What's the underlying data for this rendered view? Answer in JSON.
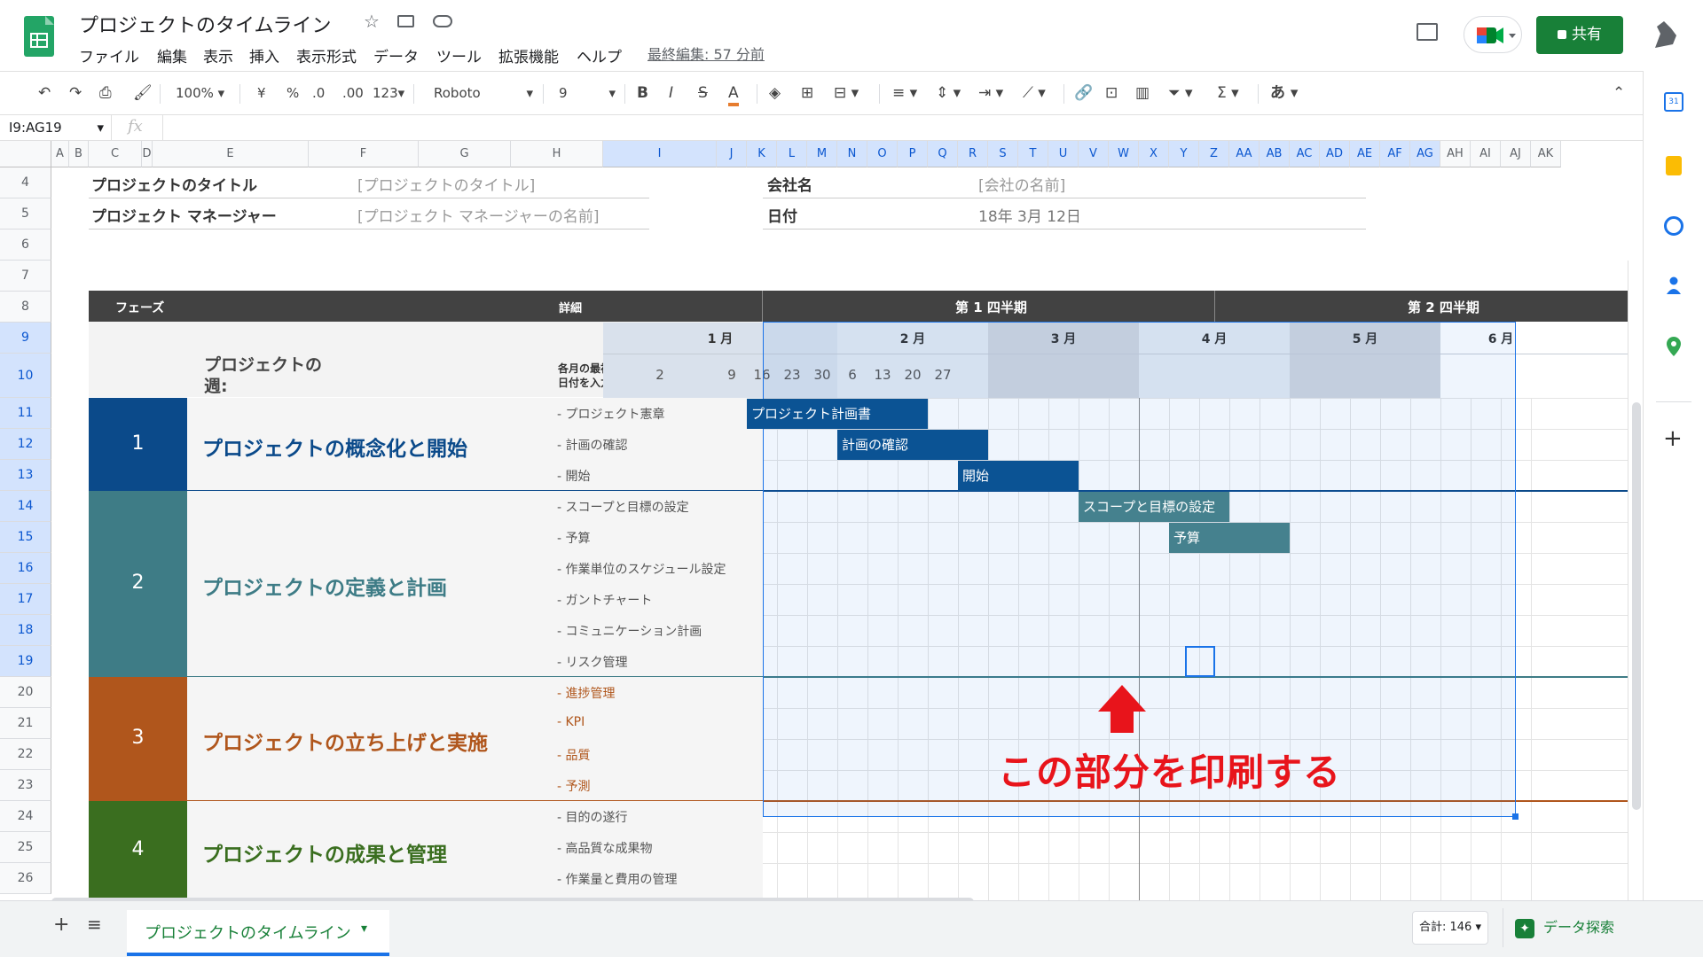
{
  "doc": {
    "title": "プロジェクトのタイムライン",
    "last_edit": "最終編集: 57 分前",
    "share_label": "共有"
  },
  "menu": [
    "ファイル",
    "編集",
    "表示",
    "挿入",
    "表示形式",
    "データ",
    "ツール",
    "拡張機能",
    "ヘルプ"
  ],
  "toolbar": {
    "zoom": "100%",
    "currency": "¥",
    "percent": "%",
    "dec_minus": ".0",
    "dec_plus": ".00",
    "format_num": "123",
    "font": "Roboto",
    "size": "9",
    "bold": "B",
    "italic": "I",
    "strike": "S",
    "text_color": "A",
    "input_tools": "あ"
  },
  "formula": {
    "name_box": "I9:AG19",
    "fx": "fx"
  },
  "columns": [
    "A",
    "B",
    "C",
    "D",
    "E",
    "F",
    "G",
    "H",
    "I",
    "J",
    "K",
    "L",
    "M",
    "N",
    "O",
    "P",
    "Q",
    "R",
    "S",
    "T",
    "U",
    "V",
    "W",
    "X",
    "Y",
    "Z",
    "AA",
    "AB",
    "AC",
    "AD",
    "AE",
    "AF",
    "AG",
    "AH",
    "AI",
    "AJ",
    "AK"
  ],
  "rows": [
    "4",
    "5",
    "6",
    "7",
    "8",
    "9",
    "10",
    "11",
    "12",
    "13",
    "14",
    "15",
    "16",
    "17",
    "18",
    "19",
    "20",
    "21",
    "22",
    "23",
    "24",
    "25",
    "26"
  ],
  "info": {
    "title_label": "プロジェクトのタイトル",
    "title_value": "[プロジェクトのタイトル]",
    "pm_label": "プロジェクト マネージャー",
    "pm_value": "[プロジェクト マネージャーの名前]",
    "company_label": "会社名",
    "company_value": "[会社の名前]",
    "date_label": "日付",
    "date_value": "18年 3月 12日"
  },
  "table_header": {
    "phase": "フェーズ",
    "detail": "詳細",
    "q1": "第 1 四半期",
    "q2": "第 2 四半期"
  },
  "months": [
    "1 月",
    "2 月",
    "3 月",
    "4 月",
    "5 月",
    "6 月"
  ],
  "week": {
    "label": "プロジェクトの\n週:",
    "hint_line1": "各月の最初の月曜日の",
    "hint_line2": "日付を入力します -->",
    "dates": [
      "2",
      "9",
      "16",
      "23",
      "30",
      "6",
      "13",
      "20",
      "27"
    ]
  },
  "phases": [
    {
      "num": "1",
      "name": "プロジェクトの概念化と開始",
      "color": "#0b4a8a",
      "text_color": "#0b4a8a",
      "tasks": [
        "- プロジェクト憲章",
        "- 計画の確認",
        "- 開始"
      ]
    },
    {
      "num": "2",
      "name": "プロジェクトの定義と計画",
      "color": "#3e7c86",
      "text_color": "#3e7c86",
      "tasks": [
        "- スコープと目標の設定",
        "- 予算",
        "- 作業単位のスケジュール設定",
        "- ガントチャート",
        "- コミュニケーション計画",
        "- リスク管理"
      ]
    },
    {
      "num": "3",
      "name": "プロジェクトの立ち上げと実施",
      "color": "#b0561c",
      "text_color": "#b0561c",
      "tasks": [
        "- 進捗管理",
        "- KPI",
        "- 品質",
        "- 予測"
      ]
    },
    {
      "num": "4",
      "name": "プロジェクトの成果と管理",
      "color": "#3a6e1f",
      "text_color": "#3a6e1f",
      "tasks": [
        "- 目的の遂行",
        "- 高品質な成果物",
        "- 作業量と費用の管理"
      ]
    }
  ],
  "bars": [
    {
      "label": "プロジェクト計画書",
      "color": "#0b5394"
    },
    {
      "label": "計画の確認",
      "color": "#0b5394"
    },
    {
      "label": "開始",
      "color": "#0b5394"
    },
    {
      "label": "スコープと目標の設定",
      "color": "#45818e"
    },
    {
      "label": "予算",
      "color": "#45818e"
    }
  ],
  "annotation": "この部分を印刷する",
  "bottom": {
    "sheet_tab": "プロジェクトのタイムライン",
    "sum": "合計: 146",
    "explore": "データ探索"
  }
}
